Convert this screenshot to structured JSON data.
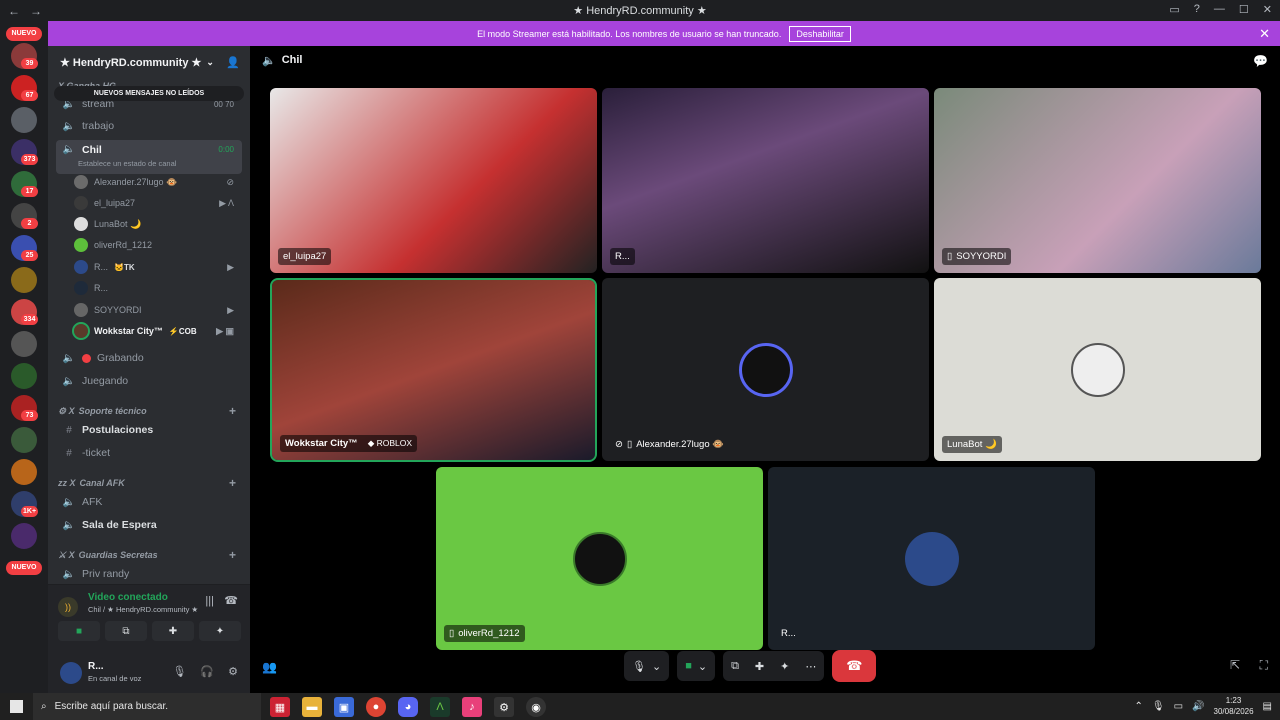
{
  "window": {
    "title": "★ HendryRD.community ★",
    "back": "←",
    "forward": "→"
  },
  "banner": {
    "text": "El modo Streamer está habilitado. Los nombres de usuario se han truncado.",
    "button": "Deshabilitar"
  },
  "rail": {
    "new_top": "NUEVO",
    "new_bottom": "NUEVO",
    "badges": [
      "39",
      "67",
      "373",
      "17",
      "2",
      "25",
      "334",
      "73",
      "1K+"
    ]
  },
  "sidebar": {
    "guild_name": "★ HendryRD.community ★",
    "unread_pill": "NUEVOS MENSAJES NO LEÍDOS",
    "top_category": "X Gangha HG",
    "channels": [
      {
        "name": "stream",
        "extra": "00  70"
      },
      {
        "name": "trabajo"
      },
      {
        "name": "Chil",
        "time": "0:00",
        "status": "Establece un estado de canal"
      },
      {
        "name": "Grabando"
      },
      {
        "name": "Juegando"
      }
    ],
    "chil_users": [
      {
        "name": "Alexander.27lugo 🐵"
      },
      {
        "name": "el_luipa27"
      },
      {
        "name": "LunaBot 🌙"
      },
      {
        "name": "oliverRd_1212"
      },
      {
        "name": "R...",
        "tag": "🐱TK"
      },
      {
        "name": "R..."
      },
      {
        "name": "SOYYORDI"
      },
      {
        "name": "Wokkstar City™",
        "tag": "⚡COB"
      }
    ],
    "cat_support": "Soporte técnico",
    "support_channels": [
      "Postulaciones",
      "-ticket"
    ],
    "cat_afk": "Canal AFK",
    "afk_channels": [
      "AFK",
      "Sala de Espera"
    ],
    "cat_secret": "Guardias Secretas",
    "secret_channels": [
      "Priv randy"
    ]
  },
  "voice_panel": {
    "title": "Video conectado",
    "subtitle": "Chil / ★ HendryRD.community ★"
  },
  "user_panel": {
    "name": "R...",
    "status": "En canal de voz"
  },
  "stage": {
    "channel": "Chil",
    "tiles": [
      {
        "name": "el_luipa27"
      },
      {
        "name": "R..."
      },
      {
        "name": "SOYYORDI"
      },
      {
        "name": "Wokkstar City™",
        "activity": "ROBLOX"
      },
      {
        "name": "Alexander.27lugo 🐵"
      },
      {
        "name": "LunaBot 🌙"
      },
      {
        "name": "oliverRd_1212"
      },
      {
        "name": "R..."
      }
    ]
  },
  "taskbar": {
    "search_placeholder": "Escribe aquí para buscar.",
    "time": "1:23",
    "date": "30/08/2026"
  },
  "colors": {
    "accent": "#5865f2",
    "banner": "#a743dc",
    "online": "#23a55a",
    "danger": "#da373c"
  }
}
